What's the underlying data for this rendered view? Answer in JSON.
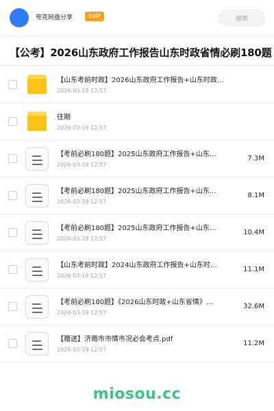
{
  "header": {
    "share_name": "夸克网盘分享",
    "badge": "SVIP",
    "search_placeholder": "搜索"
  },
  "page_title": "【公考】2026山东政府工作报告山东时政省情必刷180题",
  "files": [
    {
      "type": "folder",
      "name": "【山东考前时政】2026山东政府工作报告+山东时政…",
      "date": "2026-03-19 12:57",
      "size": ""
    },
    {
      "type": "folder",
      "name": "往期",
      "date": "2026-03-19 12:57",
      "size": ""
    },
    {
      "type": "file",
      "name": "【考前必刷180题】2025山东政府工作报告+山东…",
      "date": "2026-03-19 12:57",
      "size": "7.3M"
    },
    {
      "type": "file",
      "name": "【考前必刷180题】2025山东政府工作报告+山东…",
      "date": "2026-03-19 12:57",
      "size": "8.1M"
    },
    {
      "type": "file",
      "name": "【考前必刷180题】2025山东政府工作报告+山东…",
      "date": "2026-03-19 12:57",
      "size": "10.4M"
    },
    {
      "type": "file",
      "name": "【山东考前时政】2024山东政府工作报告+山东时…",
      "date": "2026-03-19 12:57",
      "size": "11.1M"
    },
    {
      "type": "file",
      "name": "【考前必刷180题】《2026山东时政+山东省情》…",
      "date": "2026-03-19 12:57",
      "size": "32.6M"
    },
    {
      "type": "file",
      "name": "【赠送】济南市市情市况必会考点.pdf",
      "date": "2026-03-19 12:57",
      "size": "11.2M"
    }
  ],
  "watermark": "miosou.cc",
  "colors": {
    "avatar": "#2f7cf6",
    "badge": "#f7a123",
    "folder": "#ffc21a",
    "watermark": "#3fc27e"
  }
}
